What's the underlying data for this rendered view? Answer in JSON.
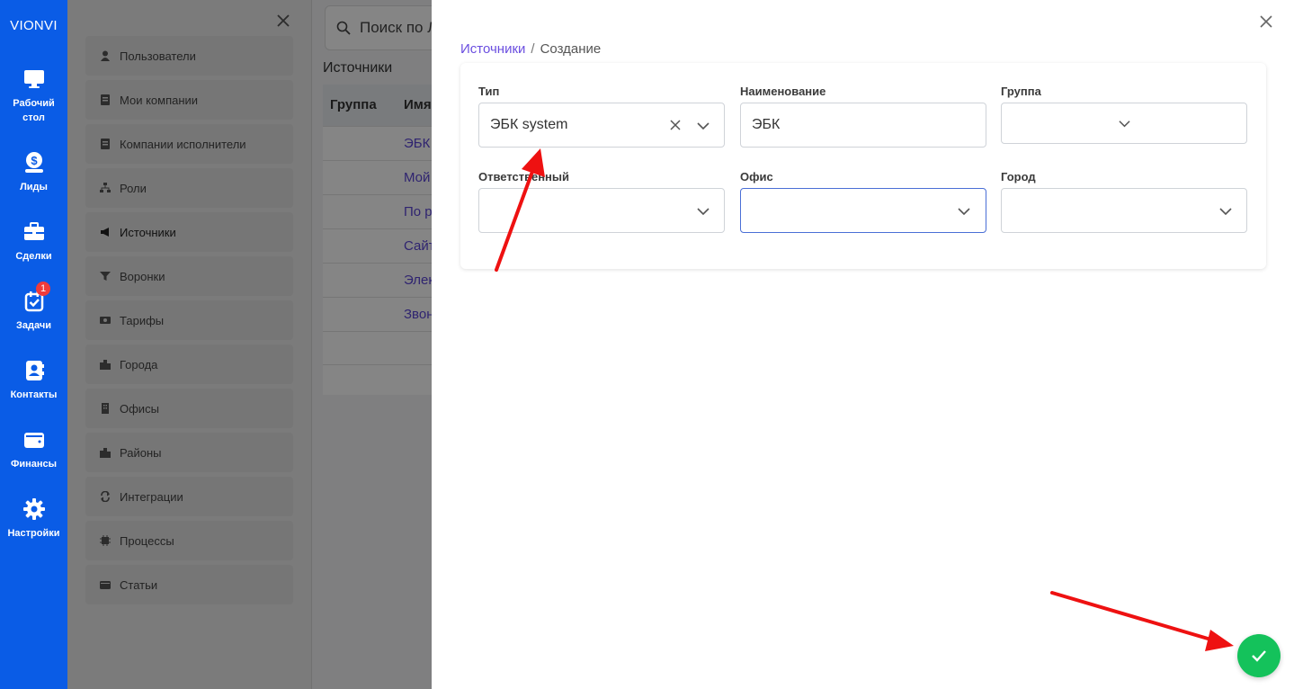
{
  "brand": "VIONVI",
  "nav": [
    {
      "label_l1": "Рабочий",
      "label_l2": "стол",
      "icon": "desktop-icon"
    },
    {
      "label_l1": "Лиды",
      "label_l2": "",
      "icon": "dollar-icon"
    },
    {
      "label_l1": "Сделки",
      "label_l2": "",
      "icon": "briefcase-icon"
    },
    {
      "label_l1": "Задачи",
      "label_l2": "",
      "icon": "task-icon",
      "badge": "1"
    },
    {
      "label_l1": "Контакты",
      "label_l2": "",
      "icon": "contact-icon"
    },
    {
      "label_l1": "Финансы",
      "label_l2": "",
      "icon": "wallet-icon"
    },
    {
      "label_l1": "Настройки",
      "label_l2": "",
      "icon": "gear-icon"
    }
  ],
  "settings_menu": [
    {
      "label": "Пользователи",
      "icon": "user-icon"
    },
    {
      "label": "Мои компании",
      "icon": "company-icon"
    },
    {
      "label": "Компании исполнители",
      "icon": "company-icon"
    },
    {
      "label": "Роли",
      "icon": "hierarchy-icon"
    },
    {
      "label": "Источники",
      "icon": "megaphone-icon"
    },
    {
      "label": "Воронки",
      "icon": "funnel-icon"
    },
    {
      "label": "Тарифы",
      "icon": "money-icon"
    },
    {
      "label": "Города",
      "icon": "city-icon"
    },
    {
      "label": "Офисы",
      "icon": "building-icon"
    },
    {
      "label": "Районы",
      "icon": "city-icon"
    },
    {
      "label": "Интеграции",
      "icon": "sync-icon"
    },
    {
      "label": "Процессы",
      "icon": "chip-icon"
    },
    {
      "label": "Статьи",
      "icon": "wallet-icon"
    }
  ],
  "main": {
    "search_placeholder": "Поиск по Л",
    "section_title": "Источники",
    "columns": [
      "Группа",
      "Имя"
    ],
    "rows": [
      "ЭБК",
      "Мой",
      "По р",
      "Сайт",
      "Элек",
      "Звон"
    ]
  },
  "drawer": {
    "breadcrumb_link": "Источники",
    "breadcrumb_sep": "/",
    "breadcrumb_current": "Создание",
    "fields": {
      "type": {
        "label": "Тип",
        "value": "ЭБК system"
      },
      "name": {
        "label": "Наименование",
        "value": "ЭБК"
      },
      "group": {
        "label": "Группа",
        "value": ""
      },
      "responsible": {
        "label": "Ответственный",
        "value": ""
      },
      "office": {
        "label": "Офис",
        "value": ""
      },
      "city": {
        "label": "Город",
        "value": ""
      }
    }
  },
  "colors": {
    "nav_blue": "#0a5ce6",
    "link_purple": "#6b4fe0",
    "submit_green": "#14c25b",
    "annotation_red": "#ee1111",
    "badge_red": "#ef3b3b"
  }
}
